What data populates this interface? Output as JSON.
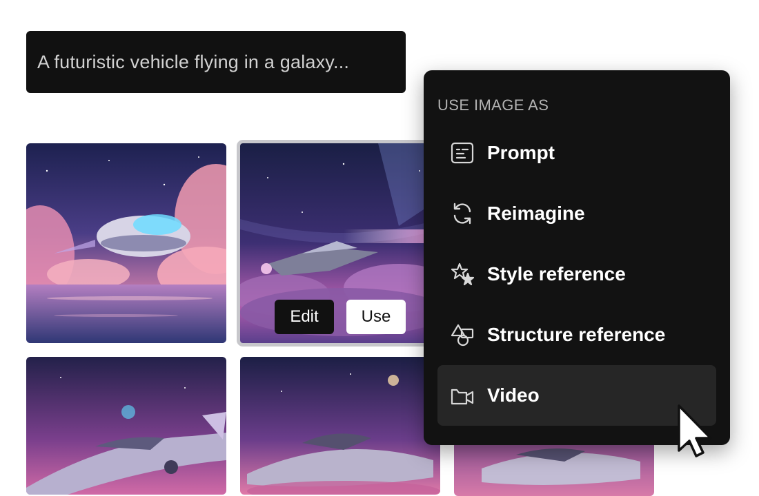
{
  "prompt": {
    "text": "A futuristic vehicle flying in a galaxy..."
  },
  "gallery": {
    "selected_actions": {
      "edit_label": "Edit",
      "use_label": "Use"
    }
  },
  "menu": {
    "heading": "USE IMAGE AS",
    "items": [
      {
        "label": "Prompt",
        "icon": "prompt-icon"
      },
      {
        "label": "Reimagine",
        "icon": "reimagine-icon"
      },
      {
        "label": "Style reference",
        "icon": "style-reference-icon"
      },
      {
        "label": "Structure reference",
        "icon": "structure-reference-icon"
      },
      {
        "label": "Video",
        "icon": "video-icon",
        "hovered": true
      }
    ]
  },
  "colors": {
    "menu_background": "#121212",
    "menu_hover": "#262626",
    "prompt_background": "#111111",
    "selected_border": "#c7c7cb"
  }
}
